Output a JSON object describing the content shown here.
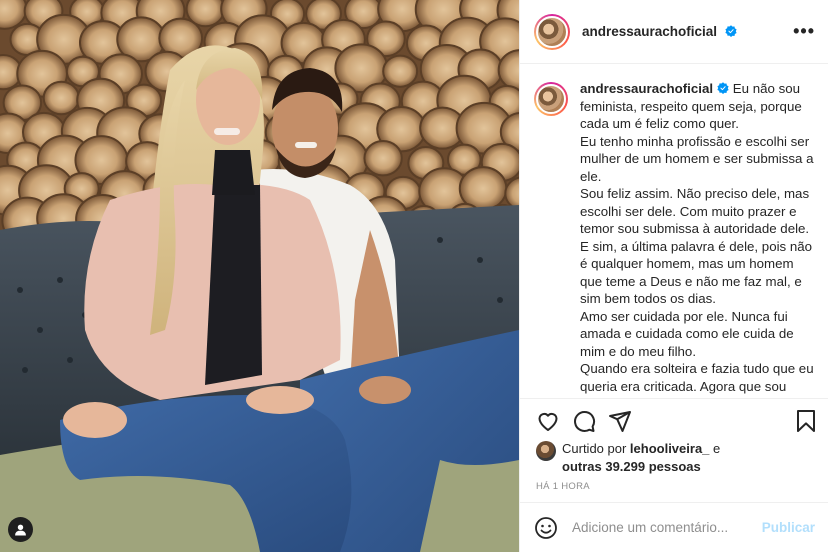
{
  "post": {
    "username": "andressaurachoficial",
    "more_icon": "more-horizontal-icon",
    "caption_lines": [
      "Eu não sou feminista, respeito quem seja, porque cada um é feliz como quer.",
      "Eu tenho minha profissão e escolhi ser mulher de um homem e ser submissa a ele.",
      "Sou feliz assim. Não preciso dele, mas escolhi ser dele. Com muito prazer e temor sou submissa à autoridade dele. E sim, a última palavra é dele, pois não é qualquer homem, mas um homem que teme a Deus e não me faz mal, e sim bem todos os dias.",
      "Amo ser cuidada por ele. Nunca fui amada e cuidada como ele cuida de mim e do meu filho.",
      "Quando era solteira e fazia tudo que eu queria era criticada. Agora que sou casada e submissa ao meu marido"
    ],
    "likes": {
      "prefix": "Curtido por ",
      "first_liker": "lehooliveira_",
      "joiner": " e",
      "others": "outras 39.299 pessoas"
    },
    "time_ago": "HÁ 1 HORA",
    "comment": {
      "placeholder": "Adicione um comentário...",
      "value": "",
      "publish_label": "Publicar"
    },
    "icons": [
      "heart-icon",
      "comment-icon",
      "share-icon",
      "bookmark-icon",
      "emoji-icon",
      "verified-icon",
      "user-tag-icon"
    ]
  },
  "colors": {
    "verified_blue": "#0095f6",
    "publish_disabled": "#b2dffc",
    "muted": "#8e8e8e"
  }
}
